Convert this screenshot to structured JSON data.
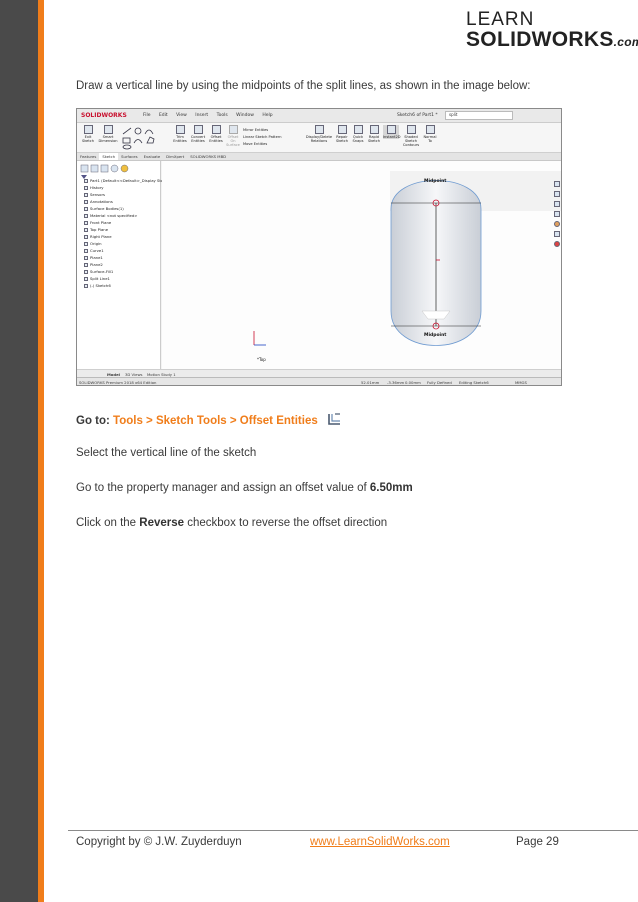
{
  "logo": {
    "line1": "LEARN",
    "line2": "SOLIDWORKS",
    "suffix": ".com"
  },
  "paragraphs": {
    "intro": "Draw a vertical line by using the midpoints of the split lines, as shown in the image below:",
    "goto_prefix": "Go to: ",
    "goto_path": "Tools > Sketch Tools > Offset Entities",
    "select": "Select the vertical line of the sketch",
    "assign_prefix": "Go to the property manager and assign an offset value of ",
    "assign_value": "6.50mm",
    "reverse_prefix": "Click on the ",
    "reverse_bold": "Reverse",
    "reverse_suffix": " checkbox to reverse the offset direction"
  },
  "screenshot": {
    "brand": "SOLIDWORKS",
    "menu": [
      "File",
      "Edit",
      "View",
      "Insert",
      "Tools",
      "Window",
      "Help"
    ],
    "doc_title": "Sketch6 of Part1 *",
    "search": "split",
    "ribbon": {
      "exit_sketch": "Exit Sketch",
      "smart_dimension": "Smart Dimension",
      "trim_entities": "Trim Entities",
      "convert_entities": "Convert Entities",
      "offset_entities": "Offset Entities",
      "offset_on_surface": "Offset On Surface",
      "mirror_entities": "Mirror Entities",
      "linear_pattern": "Linear Sketch Pattern",
      "move_entities": "Move Entities",
      "display_delete": "Display/Delete Relations",
      "repair_sketch": "Repair Sketch",
      "quick_snaps": "Quick Snaps",
      "rapid_sketch": "Rapid Sketch",
      "instant2d": "Instant2D",
      "shaded_contours": "Shaded Sketch Contours",
      "normal_to": "Normal To"
    },
    "tabs": [
      "Features",
      "Sketch",
      "Surfaces",
      "Evaluate",
      "DimXpert",
      "SOLIDWORKS MBD"
    ],
    "active_tab": "Sketch",
    "tree": [
      "Part1  (Default<<Default>_Display State",
      "History",
      "Sensors",
      "Annotations",
      "Surface Bodies(1)",
      "Material <not specified>",
      "Front Plane",
      "Top Plane",
      "Right Plane",
      "Origin",
      "Curve1",
      "Plane1",
      "Plane2",
      "Surface-Fill1",
      "Split Line1",
      "(-) Sketch6"
    ],
    "viewport": {
      "top_label": "Midpoint",
      "bottom_label": "Midpoint",
      "view_name": "*Top"
    },
    "bottom_tabs": [
      "Model",
      "3D Views",
      "Motion Study 1"
    ],
    "status": {
      "edition": "SOLIDWORKS Premium 2018 x64 Edition",
      "x": "52.01mm",
      "y": "-3.36mm",
      "z": "0.00mm",
      "state": "Fully Defined",
      "editing": "Editing Sketch6",
      "units": "MMGS"
    }
  },
  "footer": {
    "copyright": "Copyright by © J.W. Zuyderduyn",
    "link": "www.LearnSolidWorks.com",
    "page": "Page 29"
  },
  "colors": {
    "accent": "#f07d1a",
    "sidebar": "#4a4a4a",
    "text": "#3a3a3a",
    "midpoint_marker": "#c8102e"
  }
}
